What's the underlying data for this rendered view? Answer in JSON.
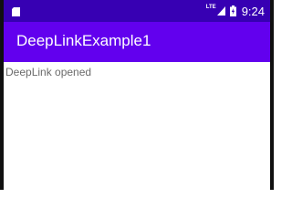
{
  "status_bar": {
    "network_label": "LTE",
    "time": "9:24",
    "background_color": "#3700b3",
    "icons": [
      "sd-card-icon",
      "signal-icon",
      "battery-charging-icon"
    ]
  },
  "app_bar": {
    "title": "DeepLinkExample1",
    "background_color": "#6200ee"
  },
  "content": {
    "message": "DeepLink opened"
  }
}
